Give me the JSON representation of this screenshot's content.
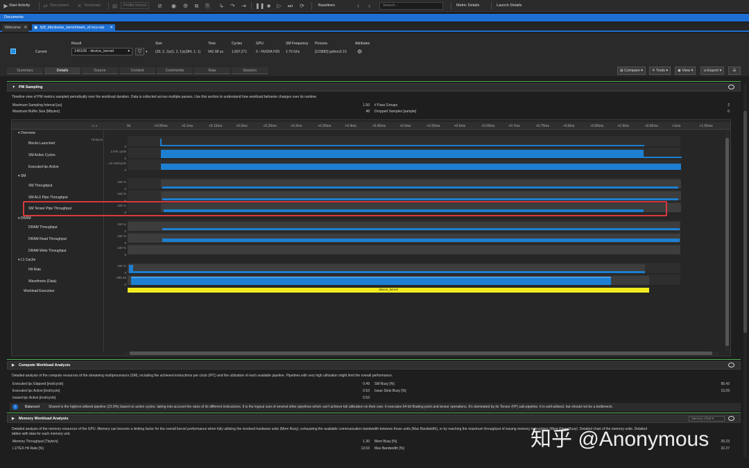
{
  "toolbar": {
    "start_activity": "Start Activity",
    "disconnect": "Disconnect",
    "terminate": "Terminate",
    "profile_kernel": "Profile Kernel",
    "baselines": "Baselines",
    "search_placeholder": "Search...",
    "metric_details": "Metric Details",
    "launch_details": "Launch Details"
  },
  "documents_label": "Documents",
  "tabs": {
    "welcome": "Welcome",
    "report": "fp8_blockwise_benchmark_sf.ncu-rep"
  },
  "header": {
    "current_label": "Current",
    "result_label": "Result",
    "result_value": "145105 - device_kernel",
    "size_label": "Size",
    "size_value": "(39, 2, 1)x(1, 2, 1)x(384, 1, 1)",
    "time_label": "Time",
    "time_value": "942.08 us",
    "cycles_label": "Cycles",
    "cycles_value": "1,697,271",
    "gpu_label": "GPU",
    "gpu_value": "0 - NVIDIA H20",
    "sm_freq_label": "SM Frequency",
    "sm_freq_value": "1.79 Ghz",
    "process_label": "Process",
    "process_value": "[123682] python3.10",
    "attributes_label": "Attributes"
  },
  "subtabs": [
    "Summary",
    "Details",
    "Source",
    "Context",
    "Comments",
    "Raw",
    "Session"
  ],
  "actions": {
    "compare": "Compare",
    "tools": "Tools",
    "view": "View",
    "export": "Export"
  },
  "pm_sampling": {
    "title": "PM Sampling",
    "description": "Timeline view of PM metrics sampled periodically over the workload duration. Data is collected across multiple passes. Use this section to understand how workload behavior changes over its runtime.",
    "metrics": [
      {
        "name": "Maximum Sampling Interval [us]",
        "value": "1.50"
      },
      {
        "name": "Maximum Buffer Size [Mbytes]",
        "value": "48"
      },
      {
        "name": "# Pass Groups",
        "value": "2"
      },
      {
        "name": "Dropped Samples [sample]",
        "value": "0"
      }
    ],
    "zoom": "1x",
    "ticks": [
      "0s",
      "+0.05ms",
      "+0.1ms",
      "+0.15ms",
      "+0.2ms",
      "+0.25ms",
      "+0.3ms",
      "+0.35ms",
      "+0.4ms",
      "+0.45ms",
      "+0.5ms",
      "+0.55ms",
      "+0.6ms",
      "+0.65ms",
      "+0.7ms",
      "+0.75ms",
      "+0.8ms",
      "+0.85ms",
      "+0.9ms",
      "+0.95ms",
      "+1ms",
      "+1.05ms"
    ],
    "groups": {
      "overview": "Overview",
      "sm": "SM",
      "dram": "DRAM",
      "l1": "L1 Cache"
    },
    "rows": {
      "blocks_launched": "Blocks Launched",
      "sm_active_cycles": "SM Active Cycles",
      "executed_ipc": "Executed Ipc Active",
      "sm_throughput": "SM Throughput",
      "sm_alu": "SM ALU Pipe Throughput",
      "sm_tensor": "SM Tensor Pipe Throughput",
      "dram_throughput": "DRAM Throughput",
      "dram_read": "DRAM Read Throughput",
      "dram_write": "DRAM Write Throughput",
      "hit_rate": "Hit Rate",
      "wavefronts": "Wavefronts (Data)",
      "workload": "Workload Execution"
    },
    "scales": {
      "blocks": "78 block",
      "cycles": "2.97k cycle",
      "ipc": "...31 inst/cycle",
      "pct": "100 %",
      "zero": "0",
      "wave": "695.46"
    },
    "kernel_name": "device_kernel"
  },
  "compute": {
    "title": "Compute Workload Analysis",
    "description": "Detailed analysis of the compute resources of the streaming multiprocessors (SM), including the achieved instructions per clock (IPC) and the utilization of each available pipeline. Pipelines with very high utilization might limit the overall performance.",
    "metrics": [
      {
        "name": "Executed Ipc Elapsed [inst/cycle]",
        "value": "0.49"
      },
      {
        "name": "Executed Ipc Active [inst/cycle]",
        "value": "0.53"
      },
      {
        "name": "Issued Ipc Active [inst/cycle]",
        "value": "0.53"
      },
      {
        "name": "SM Busy [%]",
        "value": "95.43"
      },
      {
        "name": "Issue Slots Busy [%]",
        "value": "13.29"
      }
    ],
    "balanced_label": "Balanced",
    "balanced_text": "Shared is the highest-utilized pipeline (23.9%) based on active cycles, taking into account the rates of its different instructions. It is the logical sum of several other pipelines which can't achieve full utilization on their own. It executes 64-bit floating point and tensor operations. It's dominated by its Tensor (FP) sub-pipeline. It is well-utilized, but should not be a bottleneck."
  },
  "memory": {
    "title": "Memory Workload Analysis",
    "chart_select": "Memory Chart",
    "description": "Detailed analysis of the memory resources of the GPU. Memory can become a limiting factor for the overall kernel performance when fully utilizing the involved hardware units (Mem Busy), exhausting the available communication bandwidth between those units (Max Bandwidth), or by reaching the maximum throughput of issuing memory instructions (Mem Pipes Busy). Detailed chart of the memory units. Detailed",
    "description2": "tables with data for each memory unit.",
    "metrics": [
      {
        "name": "Memory Throughput [Tbyte/s]",
        "value": "1.30"
      },
      {
        "name": "L1/TEX Hit Rate [%]",
        "value": "13.53"
      },
      {
        "name": "Mem Busy [%]",
        "value": "26.23"
      },
      {
        "name": "Max Bandwidth [%]",
        "value": "32.27"
      }
    ]
  },
  "watermark": "知乎 @Anonymous",
  "colors": {
    "accent": "#1e6fd1",
    "bar": "#1d7fd1",
    "kernel": "#f2ec1e",
    "highlight": "#d9393e",
    "section_line": "#4caf50"
  }
}
